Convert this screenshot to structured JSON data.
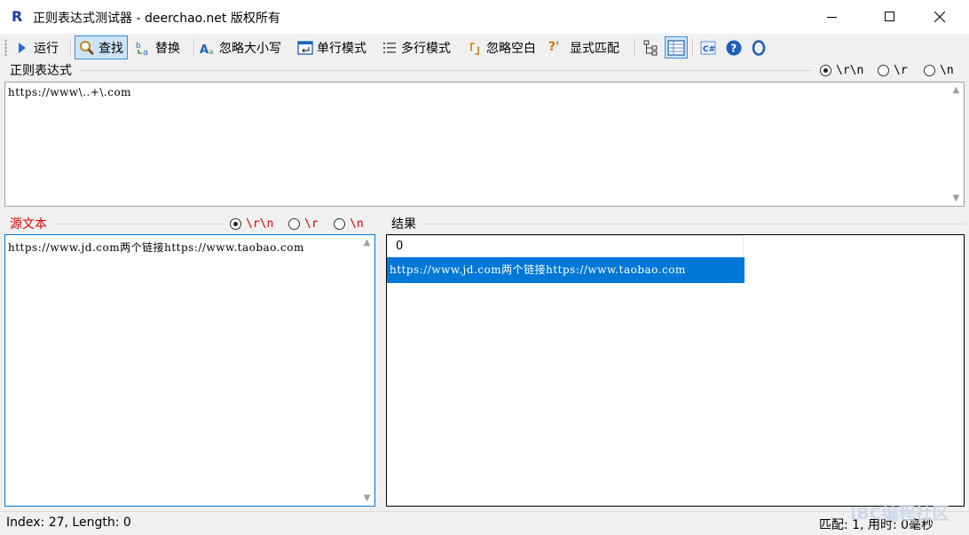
{
  "window": {
    "title": "正则表达式测试器 - deerchao.net 版权所有",
    "app_icon": "R"
  },
  "toolbar": {
    "run": "运行",
    "find": "查找",
    "replace": "替换",
    "ignore_case": "忽略大小写",
    "single_line": "单行模式",
    "multi_line": "多行模式",
    "ignore_whitespace": "忽略空白",
    "explicit_capture": "显式匹配",
    "ignore_whitespace_glyph": "「」",
    "explicit_capture_glyph": "?'"
  },
  "regex_panel": {
    "label": "正则表达式",
    "value": "https://www\\..+\\.com",
    "newline_options": [
      "\\r\\n",
      "\\r",
      "\\n"
    ],
    "selected_newline": "\\r\\n"
  },
  "source_panel": {
    "label": "源文本",
    "value": "https://www.jd.com两个链接https://www.taobao.com",
    "newline_options": [
      "\\r\\n",
      "\\r",
      "\\n"
    ],
    "selected_newline": "\\r\\n"
  },
  "result_panel": {
    "label": "结果",
    "root": "0",
    "match": "https://www.jd.com两个链接https://www.taobao.com"
  },
  "status": {
    "left": "Index: 27, Length: 0",
    "right": "匹配:   1, 用时: 0毫秒"
  },
  "watermark": "IBC编程社区",
  "colors": {
    "accent": "#0078d7",
    "label_red": "#e00000",
    "pressed": "#cce4f7"
  }
}
